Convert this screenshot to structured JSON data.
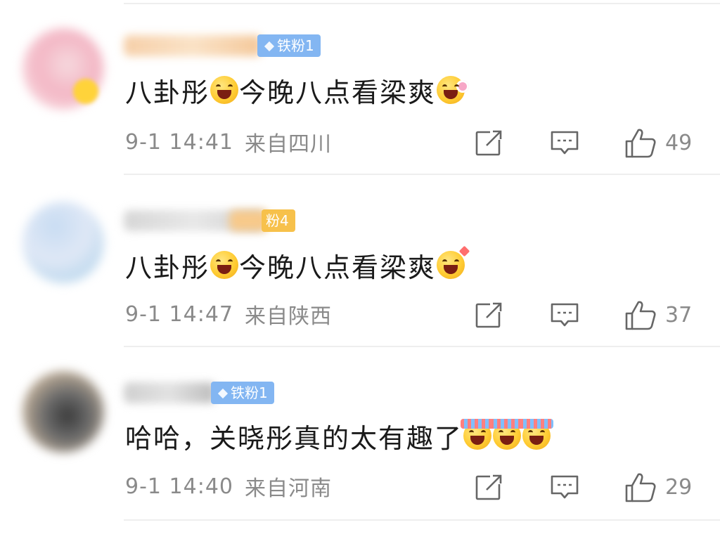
{
  "comments": [
    {
      "fan_badge": "铁粉1",
      "badge_color": "#83b6f2",
      "text": "八卦彤",
      "text_after": "今晚八点看梁爽",
      "date": "9-1",
      "time": "14:41",
      "location": "来自四川",
      "likes": "49",
      "emoji_mid": "laughing-emoji",
      "emoji_end": "flower-emoji"
    },
    {
      "fan_badge": "粉4",
      "badge_color": "#f7c14b",
      "text": "八卦彤",
      "text_after": "今晚八点看梁爽",
      "date": "9-1",
      "time": "14:47",
      "location": "来自陕西",
      "likes": "37",
      "emoji_mid": "laughing-emoji",
      "emoji_end": "heart-emoji"
    },
    {
      "fan_badge": "铁粉1",
      "badge_color": "#83b6f2",
      "text": "哈哈，关晓彤真的太有趣了",
      "text_after": "",
      "date": "9-1",
      "time": "14:40",
      "location": "来自河南",
      "likes": "29",
      "emoji_end": "cheering-emoji"
    }
  ],
  "icons": {
    "share": "share-icon",
    "reply": "comment-icon",
    "like": "thumbs-up-icon"
  }
}
